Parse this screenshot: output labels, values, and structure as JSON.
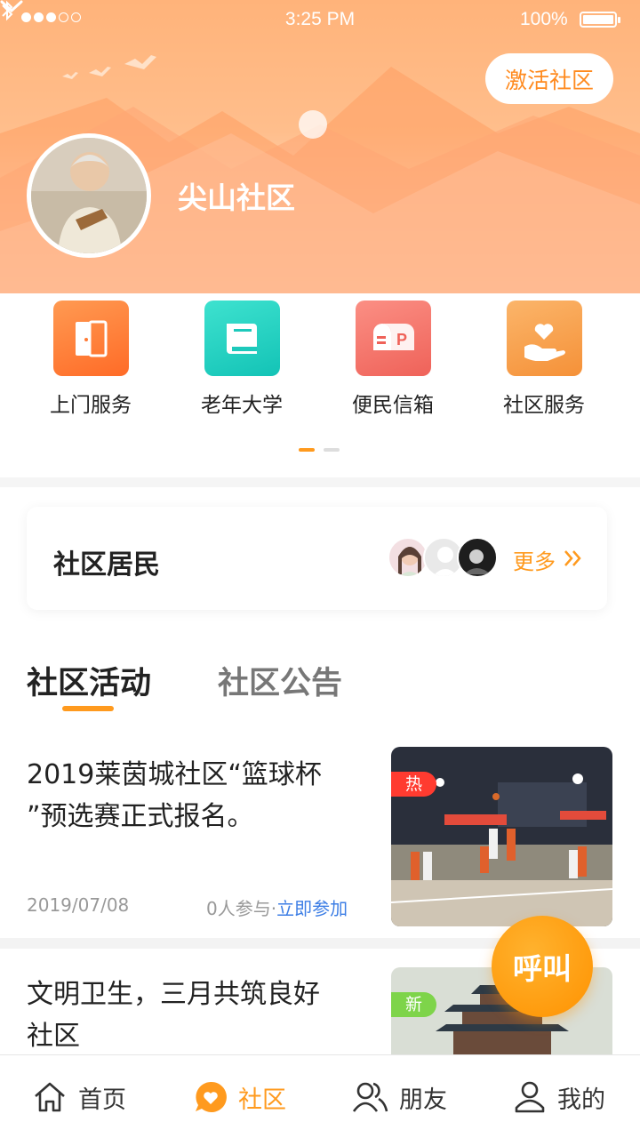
{
  "status_bar": {
    "time": "3:25 PM",
    "battery": "100%"
  },
  "header": {
    "activate_label": "激活社区",
    "community_name": "尖山社区"
  },
  "menu": [
    {
      "label": "上门服务",
      "color": "#ff7f3a"
    },
    {
      "label": "老年大学",
      "color": "#24d1c2"
    },
    {
      "label": "便民信箱",
      "color": "#f57a6e"
    },
    {
      "label": "社区服务",
      "color": "#f7a44f"
    }
  ],
  "residents": {
    "title": "社区居民",
    "more_label": "更多"
  },
  "tabs": [
    {
      "label": "社区活动",
      "active": true
    },
    {
      "label": "社区公告",
      "active": false
    }
  ],
  "articles": [
    {
      "title_line1": "2019莱茵城社区“篮球杯",
      "title_line2": "”预选赛正式报名。",
      "date": "2019/07/08",
      "participants": "0人参与·",
      "join_label": "立即参加",
      "badge": "热",
      "badge_color": "#ff3b30"
    },
    {
      "title_line1": "文明卫生，三月共筑良好",
      "title_line2": "社区",
      "badge": "新",
      "badge_color": "#7ed44a"
    }
  ],
  "call_button": "呼叫",
  "tabbar": [
    {
      "label": "首页",
      "icon": "home-icon"
    },
    {
      "label": "社区",
      "icon": "community-heart-icon",
      "active": true
    },
    {
      "label": "朋友",
      "icon": "friends-icon"
    },
    {
      "label": "我的",
      "icon": "profile-icon"
    }
  ],
  "colors": {
    "accent": "#ff9a1e",
    "link": "#3d7ee5"
  }
}
